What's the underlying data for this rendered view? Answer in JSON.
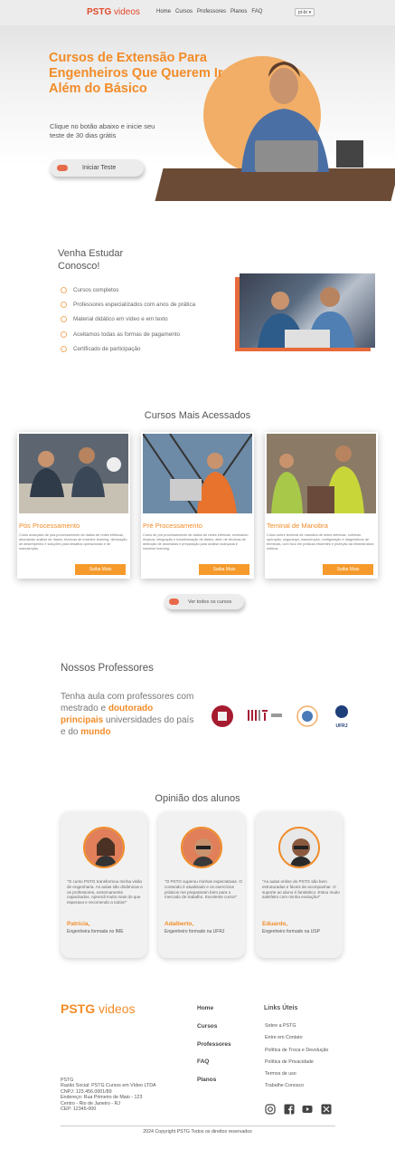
{
  "nav": {
    "logo_strong": "PSTG",
    "logo_light": "videos",
    "links": [
      "Home",
      "Cursos",
      "Professores",
      "Planos",
      "FAQ"
    ],
    "language": "pt-br"
  },
  "hero": {
    "title": "Cursos de Extensão Para Engenheiros Que Querem Ir Além do Básico",
    "subtitle": "Clique no botão abaixo e inicie seu teste de 30 dias grátis",
    "button": "Iniciar Teste"
  },
  "why": {
    "title": "Venha Estudar Conosco!",
    "items": [
      "Cursos completos",
      "Professores especializados com anos de prática",
      "Material didático em vídeo e em texto",
      "Aceitamos todas as formas de pagamento",
      "Certificado de participação"
    ]
  },
  "courses": {
    "title": "Cursos Mais Acessados",
    "see_all": "Ver todos os cursos",
    "items": [
      {
        "title": "Pós Processamento",
        "desc": "Curso avançado de pós-processamento de dados de redes elétricas, abordando análise de dados, técnicas de machine learning, otimização de desempenho e soluções para desafios operacionais e de manutenção.",
        "button": "Saiba Mais"
      },
      {
        "title": "Pré Processamento",
        "desc": "Curso de pré-processamento de dados de redes elétricas, ensinando limpeza, integração e transformação de dados, além de técnicas de detecção de anomalias e preparação para análise avançada e machine learning.",
        "button": "Saiba Mais"
      },
      {
        "title": "Teminal de Manobra",
        "desc": "Curso sobre terminal de manobra de redes elétricas, cobrindo operação, segurança, manutenção, configuração e diagnósticos de terminais, com foco em práticas eficientes e proteção da infraestrutura elétrica.",
        "button": "Saiba Mais"
      }
    ]
  },
  "professors": {
    "title": "Nossos Professores",
    "text_1": "Tenha aula com professores com mestrado e ",
    "highlight_1": "doutorado principais",
    "text_2": " universidades do país e do ",
    "highlight_2": "mundo",
    "universities": [
      "harvard-logo",
      "mit-logo",
      "usp-logo",
      "ufrj-logo"
    ],
    "ufrj_label": "UFRJ"
  },
  "testimonials": {
    "title": "Opinião dos alunos",
    "items": [
      {
        "quote": "\"O curso PSTG transformou minha visão de engenharia. As aulas são dinâmicas e os professores, extremamente capacitados. Aprendi muito mais do que esperava e recomendo a todos!\"",
        "name": "Patrícia,",
        "role": "Engenheira formada no IME"
      },
      {
        "quote": "\"O PSTG superou minhas expectativas. O conteúdo é atualizado e os exercícios práticos me prepararam bem para o mercado de trabalho. Excelente curso!\"",
        "name": "Adalberto,",
        "role": "Engenheiro formado na UFRJ"
      },
      {
        "quote": "\"As aulas online do PSTG são bem estruturadas e fáceis de acompanhar. O suporte ao aluno é fantástico. Estou muito satisfeito com minha evolução!\"",
        "name": "Eduardo,",
        "role": "Engenheiro formado na USP"
      }
    ]
  },
  "footer": {
    "logo_strong": "PSTG",
    "logo_light": "videos",
    "info": [
      "PSTG",
      "Razão Social: PSTG Cursos em Vídeo LTDA",
      "CNPJ: 123.456.0001/89",
      "Endereço: Rua Primeiro de Maio - 123",
      "Centro - Rio de Janeiro - RJ",
      "CEP: 12345-000"
    ],
    "nav": [
      "Home",
      "Cursos",
      "Professores",
      "FAQ",
      "Planos"
    ],
    "links_title": "Links Úteis",
    "links": [
      "Sobre a PSTG",
      "Entre em Contato",
      "Política de Troca e Devolução",
      "Política de Privacidade",
      "Termos de uso",
      "Trabalhe Conosco"
    ],
    "social": [
      "instagram-icon",
      "facebook-icon",
      "youtube-icon",
      "x-icon"
    ],
    "copyright": "2024 Copyright PSTG Todos os direitos reservados"
  },
  "colors": {
    "accent": "#f28c28",
    "button_dot": "#e86a4a"
  }
}
